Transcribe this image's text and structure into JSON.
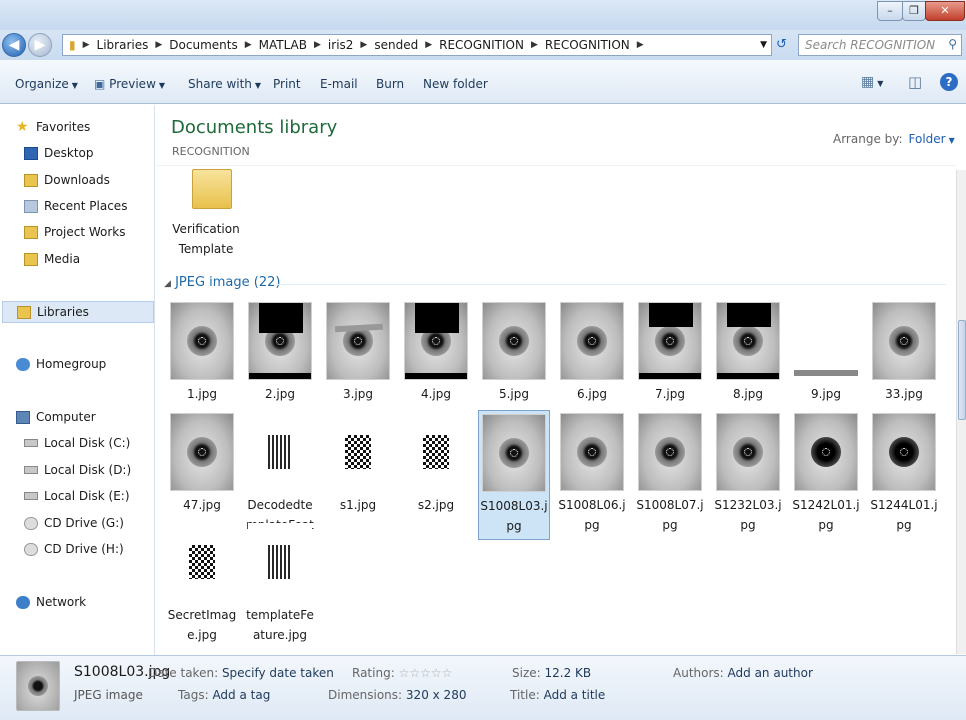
{
  "window": {
    "min_icon": "minimize-icon",
    "max_icon": "maximize-icon",
    "close_icon": "close-icon"
  },
  "nav": {
    "breadcrumb": [
      "Libraries",
      "Documents",
      "MATLAB",
      "iris2",
      "sended",
      "RECOGNITION",
      "RECOGNITION"
    ],
    "search_placeholder": "Search RECOGNITION"
  },
  "toolbar": {
    "organize": "Organize",
    "preview": "Preview",
    "share": "Share with",
    "print": "Print",
    "email": "E-mail",
    "burn": "Burn",
    "new_folder": "New folder"
  },
  "sidebar": {
    "favorites": "Favorites",
    "items": [
      "Desktop",
      "Downloads",
      "Recent Places",
      "Project Works",
      "Media"
    ],
    "libraries": "Libraries",
    "homegroup": "Homegroup",
    "computer": "Computer",
    "drives": [
      "Local Disk (C:)",
      "Local Disk (D:)",
      "Local Disk (E:)",
      "CD Drive (G:)",
      "CD Drive (H:)"
    ],
    "network": "Network"
  },
  "main": {
    "title": "Documents library",
    "subtitle": "RECOGNITION",
    "arrange_label": "Arrange by:",
    "arrange_value": "Folder",
    "folder_name": "Verification Template",
    "group_label": "JPEG image (22)",
    "files": [
      "1.jpg",
      "2.jpg",
      "3.jpg",
      "4.jpg",
      "5.jpg",
      "6.jpg",
      "7.jpg",
      "8.jpg",
      "9.jpg",
      "33.jpg",
      "47.jpg",
      "DecodedtemplateFeature.jpg",
      "s1.jpg",
      "s2.jpg",
      "S1008L03.jpg",
      "S1008L06.jpg",
      "S1008L07.jpg",
      "S1232L03.jpg",
      "S1242L01.jpg",
      "S1244L01.jpg",
      "SecretImage.jpg",
      "templateFeature.jpg"
    ],
    "selected": "S1008L03.jpg"
  },
  "status": {
    "filename": "S1008L03.jpg",
    "filetype": "JPEG image",
    "date_label": "Date taken:",
    "date_value": "Specify date taken",
    "tags_label": "Tags:",
    "tags_value": "Add a tag",
    "rating_label": "Rating:",
    "dimensions_label": "Dimensions:",
    "dimensions_value": "320 x 280",
    "size_label": "Size:",
    "size_value": "12.2 KB",
    "title_label": "Title:",
    "title_value": "Add a title",
    "authors_label": "Authors:",
    "authors_value": "Add an author"
  }
}
